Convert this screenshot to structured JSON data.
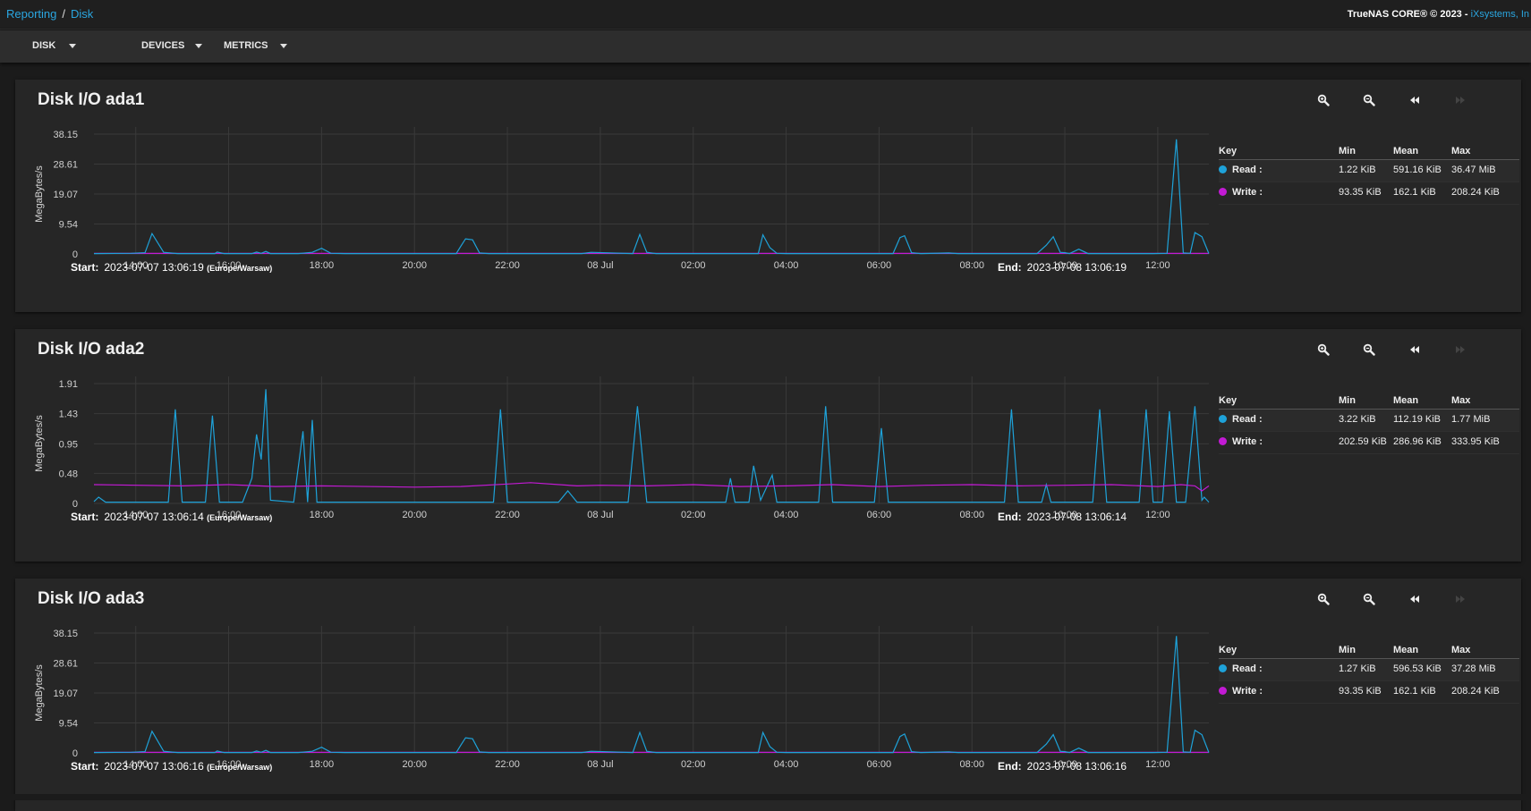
{
  "breadcrumb": {
    "root": "Reporting",
    "separator": "/",
    "current": "Disk"
  },
  "copyright": {
    "text": "TrueNAS CORE® © 2023 - ",
    "link": "iXsystems, In"
  },
  "toolbar": {
    "menus": [
      "DISK",
      "DEVICES",
      "METRICS"
    ]
  },
  "legend_header": {
    "key": "Key",
    "min": "Min",
    "mean": "Mean",
    "max": "Max"
  },
  "colors": {
    "read": "#1ea2d9",
    "write": "#c21ad4",
    "background": "#1b1b1b",
    "card": "#262626",
    "accent": "#2aa6e0"
  },
  "icons": [
    "zoom-in-icon",
    "zoom-out-icon",
    "rewind-icon",
    "forward-icon"
  ],
  "x_ticks": [
    "14:00",
    "16:00",
    "18:00",
    "20:00",
    "22:00",
    "08 Jul",
    "02:00",
    "04:00",
    "06:00",
    "08:00",
    "10:00",
    "12:00"
  ],
  "cards": [
    {
      "title": "Disk I/O ada1",
      "start_label": "Start:",
      "start_value": "2023-07-07 13:06:19",
      "tz": "(Europe/Warsaw)",
      "end_label": "End:",
      "end_value": "2023-07-08 13:06:19",
      "legend": [
        {
          "name": "Read :",
          "min": "1.22 KiB",
          "mean": "591.16 KiB",
          "max": "36.47 MiB"
        },
        {
          "name": "Write :",
          "min": "93.35 KiB",
          "mean": "162.1 KiB",
          "max": "208.24 KiB"
        }
      ]
    },
    {
      "title": "Disk I/O ada2",
      "start_label": "Start:",
      "start_value": "2023-07-07 13:06:14",
      "tz": "(Europe/Warsaw)",
      "end_label": "End:",
      "end_value": "2023-07-08 13:06:14",
      "legend": [
        {
          "name": "Read :",
          "min": "3.22 KiB",
          "mean": "112.19 KiB",
          "max": "1.77 MiB"
        },
        {
          "name": "Write :",
          "min": "202.59 KiB",
          "mean": "286.96 KiB",
          "max": "333.95 KiB"
        }
      ]
    },
    {
      "title": "Disk I/O ada3",
      "start_label": "Start:",
      "start_value": "2023-07-07 13:06:16",
      "tz": "(Europe/Warsaw)",
      "end_label": "End:",
      "end_value": "2023-07-08 13:06:16",
      "legend": [
        {
          "name": "Read :",
          "min": "1.27 KiB",
          "mean": "596.53 KiB",
          "max": "37.28 MiB"
        },
        {
          "name": "Write :",
          "min": "93.35 KiB",
          "mean": "162.1 KiB",
          "max": "208.24 KiB"
        }
      ]
    }
  ],
  "chart_data": [
    {
      "type": "line",
      "title": "Disk I/O ada1",
      "ylabel": "MegaBytes/s",
      "ylim": [
        0,
        38.15
      ],
      "yticks": [
        "0",
        "9.54",
        "19.07",
        "28.61",
        "38.15"
      ],
      "x_range_hours": [
        13.1,
        37.1
      ],
      "series": [
        {
          "name": "Read",
          "color": "#1ea2d9",
          "points": [
            [
              13.1,
              0.1
            ],
            [
              13.9,
              0.2
            ],
            [
              14.2,
              0.4
            ],
            [
              14.35,
              6.5
            ],
            [
              14.6,
              0.5
            ],
            [
              14.9,
              0.1
            ],
            [
              15.0,
              0.1
            ],
            [
              15.7,
              0.1
            ],
            [
              15.75,
              0.6
            ],
            [
              15.9,
              0.1
            ],
            [
              16.5,
              0.1
            ],
            [
              16.6,
              0.6
            ],
            [
              16.7,
              0.2
            ],
            [
              16.8,
              0.8
            ],
            [
              16.9,
              0.1
            ],
            [
              17.5,
              0.1
            ],
            [
              17.8,
              0.5
            ],
            [
              18.0,
              1.8
            ],
            [
              18.2,
              0.2
            ],
            [
              18.5,
              0.1
            ],
            [
              20.9,
              0.1
            ],
            [
              21.0,
              2.5
            ],
            [
              21.1,
              4.8
            ],
            [
              21.25,
              4.5
            ],
            [
              21.4,
              0.3
            ],
            [
              21.6,
              0.1
            ],
            [
              23.6,
              0.1
            ],
            [
              23.8,
              0.5
            ],
            [
              24.7,
              0.1
            ],
            [
              24.85,
              6.2
            ],
            [
              25.0,
              0.5
            ],
            [
              25.2,
              0.1
            ],
            [
              27.4,
              0.1
            ],
            [
              27.5,
              6.1
            ],
            [
              27.65,
              2.0
            ],
            [
              27.8,
              0.2
            ],
            [
              28.0,
              0.1
            ],
            [
              30.3,
              0.1
            ],
            [
              30.45,
              5.2
            ],
            [
              30.55,
              5.8
            ],
            [
              30.7,
              0.4
            ],
            [
              30.9,
              0.1
            ],
            [
              31.5,
              0.3
            ],
            [
              31.7,
              0.1
            ],
            [
              33.4,
              0.1
            ],
            [
              33.6,
              2.8
            ],
            [
              33.75,
              5.5
            ],
            [
              33.9,
              0.5
            ],
            [
              34.0,
              0.4
            ],
            [
              34.1,
              0.1
            ],
            [
              34.3,
              1.5
            ],
            [
              34.5,
              0.1
            ],
            [
              35.9,
              0.1
            ],
            [
              36.2,
              0.2
            ],
            [
              36.4,
              36.5
            ],
            [
              36.55,
              0.3
            ],
            [
              36.7,
              0.2
            ],
            [
              36.8,
              6.8
            ],
            [
              36.95,
              5.5
            ],
            [
              37.1,
              0.1
            ]
          ]
        },
        {
          "name": "Write",
          "color": "#c21ad4",
          "points": [
            [
              13.1,
              0.16
            ],
            [
              37.1,
              0.16
            ]
          ]
        }
      ]
    },
    {
      "type": "line",
      "title": "Disk I/O ada2",
      "ylabel": "MegaBytes/s",
      "ylim": [
        0,
        1.91
      ],
      "yticks": [
        "0",
        "0.48",
        "0.95",
        "1.43",
        "1.91"
      ],
      "x_range_hours": [
        13.1,
        37.1
      ],
      "series": [
        {
          "name": "Read",
          "color": "#1ea2d9",
          "points": [
            [
              13.1,
              0.03
            ],
            [
              13.2,
              0.1
            ],
            [
              13.35,
              0.02
            ],
            [
              14.7,
              0.02
            ],
            [
              14.85,
              1.5
            ],
            [
              15.0,
              0.02
            ],
            [
              15.5,
              0.02
            ],
            [
              15.65,
              1.4
            ],
            [
              15.8,
              0.02
            ],
            [
              16.3,
              0.02
            ],
            [
              16.5,
              0.4
            ],
            [
              16.6,
              1.1
            ],
            [
              16.7,
              0.7
            ],
            [
              16.8,
              1.82
            ],
            [
              16.9,
              0.05
            ],
            [
              17.4,
              0.02
            ],
            [
              17.6,
              1.15
            ],
            [
              17.7,
              0.02
            ],
            [
              17.8,
              1.33
            ],
            [
              17.9,
              0.02
            ],
            [
              21.7,
              0.02
            ],
            [
              21.85,
              1.5
            ],
            [
              22.0,
              0.02
            ],
            [
              23.1,
              0.02
            ],
            [
              23.3,
              0.2
            ],
            [
              23.5,
              0.02
            ],
            [
              24.6,
              0.02
            ],
            [
              24.8,
              1.55
            ],
            [
              25.0,
              0.02
            ],
            [
              26.7,
              0.02
            ],
            [
              26.8,
              0.4
            ],
            [
              26.9,
              0.02
            ],
            [
              27.2,
              0.02
            ],
            [
              27.3,
              0.6
            ],
            [
              27.45,
              0.05
            ],
            [
              27.7,
              0.45
            ],
            [
              27.8,
              0.02
            ],
            [
              28.7,
              0.02
            ],
            [
              28.85,
              1.55
            ],
            [
              29.0,
              0.02
            ],
            [
              29.9,
              0.02
            ],
            [
              30.05,
              1.2
            ],
            [
              30.2,
              0.02
            ],
            [
              32.7,
              0.02
            ],
            [
              32.85,
              1.5
            ],
            [
              33.0,
              0.02
            ],
            [
              33.5,
              0.02
            ],
            [
              33.6,
              0.3
            ],
            [
              33.7,
              0.02
            ],
            [
              34.6,
              0.02
            ],
            [
              34.75,
              1.5
            ],
            [
              34.9,
              0.02
            ],
            [
              35.6,
              0.02
            ],
            [
              35.75,
              1.5
            ],
            [
              35.9,
              0.02
            ],
            [
              36.1,
              0.02
            ],
            [
              36.25,
              1.47
            ],
            [
              36.4,
              0.02
            ],
            [
              36.6,
              0.02
            ],
            [
              36.8,
              1.55
            ],
            [
              36.95,
              0.05
            ],
            [
              37.0,
              0.1
            ],
            [
              37.1,
              0.02
            ]
          ]
        },
        {
          "name": "Write",
          "color": "#c21ad4",
          "points": [
            [
              13.1,
              0.3
            ],
            [
              15.0,
              0.28
            ],
            [
              16.0,
              0.3
            ],
            [
              17.0,
              0.27
            ],
            [
              18.0,
              0.28
            ],
            [
              20.0,
              0.26
            ],
            [
              21.0,
              0.27
            ],
            [
              22.0,
              0.31
            ],
            [
              22.5,
              0.33
            ],
            [
              23.5,
              0.28
            ],
            [
              24.0,
              0.29
            ],
            [
              25.0,
              0.28
            ],
            [
              26.0,
              0.3
            ],
            [
              27.0,
              0.27
            ],
            [
              28.0,
              0.28
            ],
            [
              29.0,
              0.3
            ],
            [
              30.0,
              0.27
            ],
            [
              31.0,
              0.29
            ],
            [
              32.0,
              0.3
            ],
            [
              33.0,
              0.28
            ],
            [
              34.0,
              0.29
            ],
            [
              35.0,
              0.3
            ],
            [
              36.0,
              0.27
            ],
            [
              36.5,
              0.3
            ],
            [
              36.8,
              0.28
            ],
            [
              36.95,
              0.2
            ],
            [
              37.1,
              0.28
            ]
          ]
        }
      ]
    },
    {
      "type": "line",
      "title": "Disk I/O ada3",
      "ylabel": "MegaBytes/s",
      "ylim": [
        0,
        38.15
      ],
      "yticks": [
        "0",
        "9.54",
        "19.07",
        "28.61",
        "38.15"
      ],
      "x_range_hours": [
        13.1,
        37.1
      ],
      "series": [
        {
          "name": "Read",
          "color": "#1ea2d9",
          "points": [
            [
              13.1,
              0.1
            ],
            [
              13.9,
              0.2
            ],
            [
              14.2,
              0.4
            ],
            [
              14.35,
              6.9
            ],
            [
              14.6,
              0.5
            ],
            [
              14.9,
              0.1
            ],
            [
              15.0,
              0.1
            ],
            [
              15.7,
              0.1
            ],
            [
              15.75,
              0.6
            ],
            [
              15.9,
              0.1
            ],
            [
              16.5,
              0.1
            ],
            [
              16.6,
              0.6
            ],
            [
              16.7,
              0.2
            ],
            [
              16.8,
              0.8
            ],
            [
              16.9,
              0.1
            ],
            [
              17.5,
              0.1
            ],
            [
              17.8,
              0.5
            ],
            [
              18.0,
              1.8
            ],
            [
              18.2,
              0.2
            ],
            [
              18.5,
              0.1
            ],
            [
              20.9,
              0.1
            ],
            [
              21.0,
              2.5
            ],
            [
              21.1,
              4.8
            ],
            [
              21.25,
              4.5
            ],
            [
              21.4,
              0.3
            ],
            [
              21.6,
              0.1
            ],
            [
              23.6,
              0.1
            ],
            [
              23.8,
              0.5
            ],
            [
              24.7,
              0.1
            ],
            [
              24.85,
              6.5
            ],
            [
              25.0,
              0.5
            ],
            [
              25.2,
              0.1
            ],
            [
              27.4,
              0.1
            ],
            [
              27.5,
              6.5
            ],
            [
              27.65,
              2.0
            ],
            [
              27.8,
              0.2
            ],
            [
              28.0,
              0.1
            ],
            [
              30.3,
              0.1
            ],
            [
              30.45,
              5.2
            ],
            [
              30.55,
              6.0
            ],
            [
              30.7,
              0.4
            ],
            [
              30.9,
              0.1
            ],
            [
              31.5,
              0.3
            ],
            [
              31.7,
              0.1
            ],
            [
              33.4,
              0.1
            ],
            [
              33.6,
              2.8
            ],
            [
              33.75,
              5.8
            ],
            [
              33.9,
              0.5
            ],
            [
              34.0,
              0.4
            ],
            [
              34.1,
              0.1
            ],
            [
              34.3,
              1.5
            ],
            [
              34.5,
              0.1
            ],
            [
              35.9,
              0.1
            ],
            [
              36.2,
              0.2
            ],
            [
              36.4,
              37.2
            ],
            [
              36.55,
              0.3
            ],
            [
              36.7,
              0.2
            ],
            [
              36.8,
              7.2
            ],
            [
              36.95,
              5.8
            ],
            [
              37.1,
              0.1
            ]
          ]
        },
        {
          "name": "Write",
          "color": "#c21ad4",
          "points": [
            [
              13.1,
              0.16
            ],
            [
              37.1,
              0.16
            ]
          ]
        }
      ]
    }
  ]
}
